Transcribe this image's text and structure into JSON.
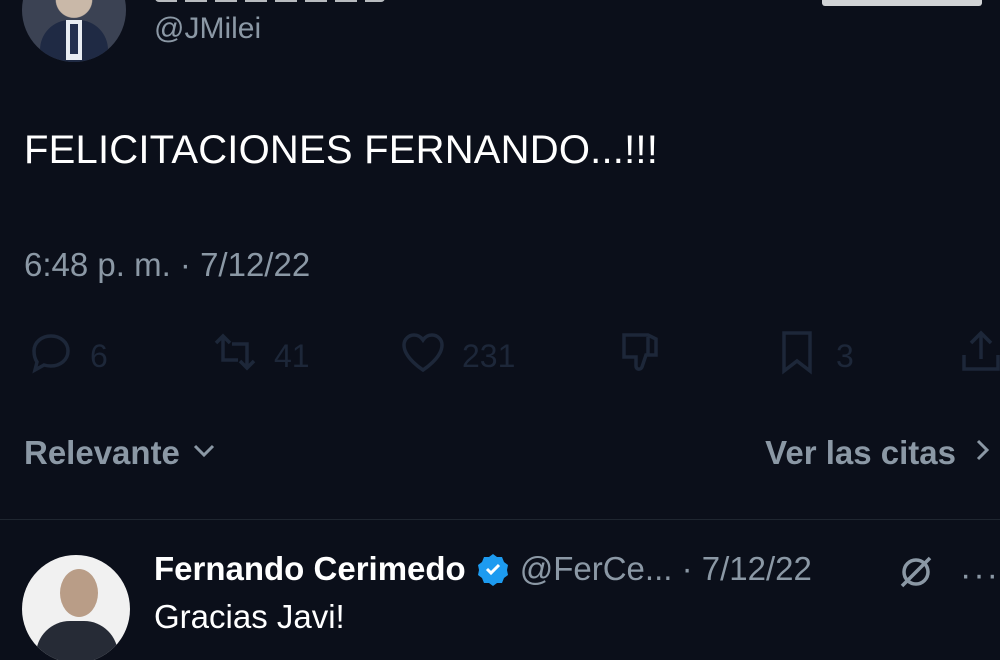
{
  "tweet": {
    "handle": "@JMilei",
    "text": "FELICITACIONES FERNANDO...!!!",
    "timestamp": "6:48 p. m. · 7/12/22"
  },
  "actions": {
    "replies": "6",
    "retweets": "41",
    "likes": "231",
    "bookmarks": "3"
  },
  "sort": {
    "relevance_label": "Relevante",
    "quotes_label": "Ver las citas"
  },
  "reply": {
    "name": "Fernando Cerimedo",
    "meta": "@FerCe... · 7/12/22",
    "text": "Gracias Javi!"
  },
  "colors": {
    "background": "#0b0f1a",
    "verified_badge": "#1d9bf0",
    "muted_text": "#8b98a5"
  }
}
